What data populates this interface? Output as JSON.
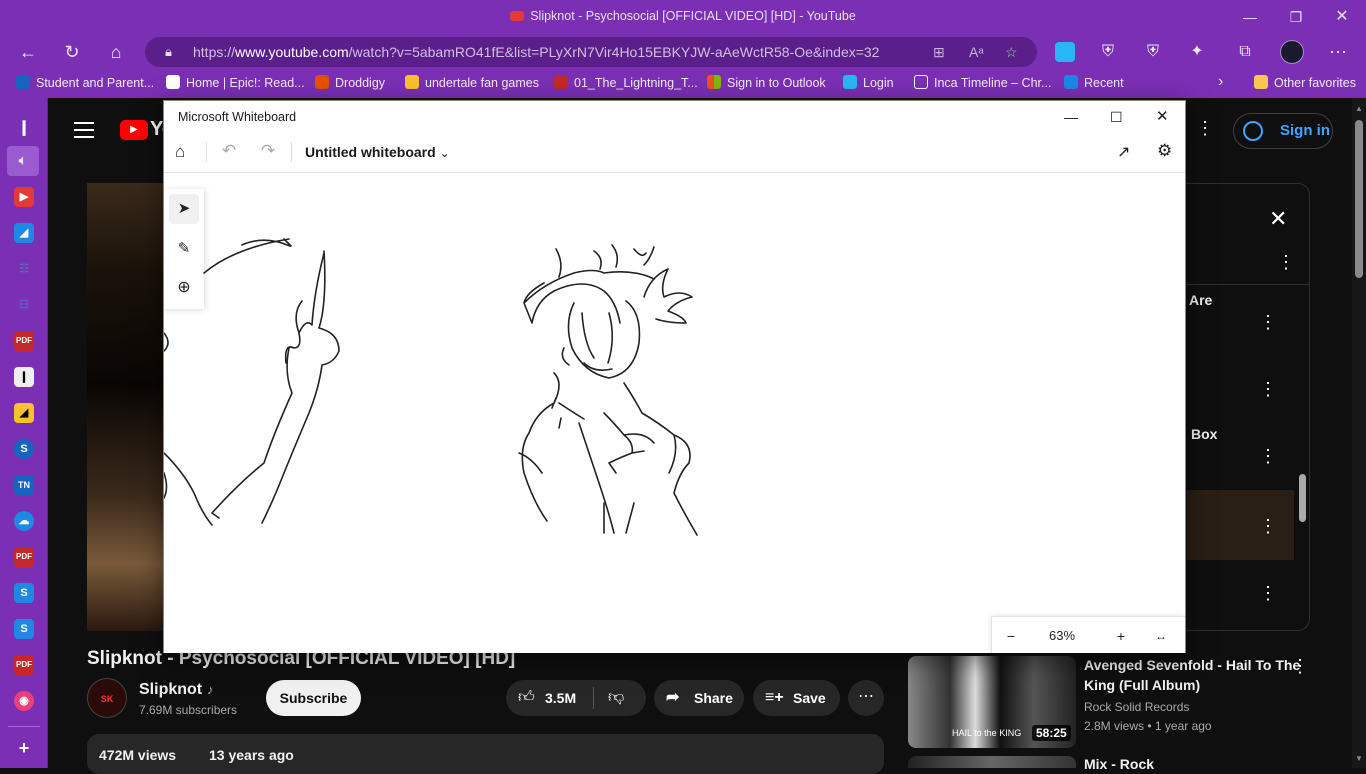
{
  "browser": {
    "window_title": "Slipknot - Psychosocial [OFFICIAL VIDEO] [HD] - YouTube",
    "url_prefix": "https://",
    "url_domain": "www.youtube.com",
    "url_rest": "/watch?v=5abamRO41fE&list=PLyXrN7Vir4Ho15EBKYJW-aAeWctR58-Oe&index=32",
    "bookmarks": [
      {
        "label": "Student and Parent...",
        "color": "#1565c0"
      },
      {
        "label": "Home | Epic!: Read...",
        "color": "#ffffff"
      },
      {
        "label": "Droddigy",
        "color": "#e65100"
      },
      {
        "label": "undertale fan games",
        "color": "#fbc02d"
      },
      {
        "label": "01_The_Lightning_T...",
        "color": "#c62828"
      },
      {
        "label": "Sign in to Outlook",
        "color": "#43a047"
      },
      {
        "label": "Login",
        "color": "#29b6f6"
      },
      {
        "label": "Inca Timeline – Chr...",
        "color": "#ffffff"
      },
      {
        "label": "Recent",
        "color": "#1e88e5"
      }
    ],
    "other_favorites": "Other favorites"
  },
  "sidebar": {
    "icons": [
      {
        "name": "speaker-icon",
        "color": "#9fa8da"
      },
      {
        "name": "youtube-icon",
        "color": "#e53935"
      },
      {
        "name": "app-blue-icon",
        "color": "#1e88e5"
      },
      {
        "name": "app-grid-icon",
        "color": "#3949ab"
      },
      {
        "name": "app-grid2-icon",
        "color": "#3949ab"
      },
      {
        "name": "pdf-icon",
        "color": "#c62828"
      },
      {
        "name": "piano-icon",
        "color": "#eeeeee"
      },
      {
        "name": "app-yellow-icon",
        "color": "#fbc02d"
      },
      {
        "name": "s-circle-icon",
        "color": "#1565c0"
      },
      {
        "name": "tn-icon",
        "color": "#1565c0"
      },
      {
        "name": "cloud-icon",
        "color": "#1e88e5"
      },
      {
        "name": "pdf2-icon",
        "color": "#c62828"
      },
      {
        "name": "s-app-icon",
        "color": "#1e88e5"
      },
      {
        "name": "s-app2-icon",
        "color": "#1e88e5"
      },
      {
        "name": "pdf3-icon",
        "color": "#c62828"
      },
      {
        "name": "record-icon",
        "color": "#ec407a"
      }
    ]
  },
  "youtube": {
    "sign_in": "Sign in",
    "video_title": "Slipknot - Psychosocial [OFFICIAL VIDEO] [HD]",
    "channel_name": "Slipknot",
    "subscribers": "7.69M subscribers",
    "subscribe": "Subscribe",
    "likes": "3.5M",
    "share": "Share",
    "save": "Save",
    "views": "472M views",
    "age": "13 years ago",
    "playlist_items": [
      {
        "label": "Are"
      },
      {
        "label": "Box"
      }
    ],
    "recommended": {
      "title_line1": "Avenged Sevenfold - Hail To The",
      "title_line2": "King (Full Album)",
      "channel": "Rock Solid Records",
      "meta": "2.8M views • 1 year ago",
      "duration": "58:25",
      "thumb_text": "HAIL to the KING"
    },
    "next_title": "Mix - Rock"
  },
  "whiteboard": {
    "window_title": "Microsoft Whiteboard",
    "board_name": "Untitled whiteboard",
    "zoom": "63%"
  }
}
